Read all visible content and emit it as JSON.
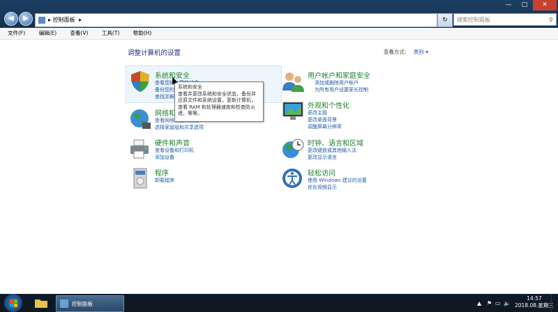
{
  "window": {
    "address_path": "控制面板",
    "address_sep": "▸",
    "search_placeholder": "搜索控制面板",
    "nav_back": "◀",
    "nav_forward": "▶",
    "refresh": "↻",
    "btn_minimize": "—",
    "btn_maximize": "□",
    "btn_close": "✕"
  },
  "menubar": {
    "items": [
      "文件(F)",
      "编辑(E)",
      "查看(V)",
      "工具(T)",
      "帮助(H)"
    ]
  },
  "main": {
    "heading": "调整计算机的设置",
    "view_by_label": "查看方式:",
    "view_by_value": "类别 ▾"
  },
  "categories": [
    {
      "title": "系统和安全",
      "links": [
        "查看您的计算机状态",
        "备份您的计算机",
        "查找并解决问题"
      ]
    },
    {
      "title": "网络和 Internet",
      "links": [
        "查看网络状态和任务",
        "选择家庭组和共享选项"
      ]
    },
    {
      "title": "硬件和声音",
      "links": [
        "查看设备和打印机",
        "添加设备"
      ]
    },
    {
      "title": "程序",
      "links": [
        "卸载程序"
      ]
    },
    {
      "title": "用户帐户和家庭安全",
      "links": [
        "添加或删除用户帐户",
        "为所有用户设置家长控制"
      ]
    },
    {
      "title": "外观和个性化",
      "links": [
        "更改主题",
        "更改桌面背景",
        "调整屏幕分辨率"
      ]
    },
    {
      "title": "时钟、语言和区域",
      "links": [
        "更改键盘或其他输入法",
        "更改显示语言"
      ]
    },
    {
      "title": "轻松访问",
      "links": [
        "使用 Windows 建议的设置",
        "优化视频显示"
      ]
    }
  ],
  "tooltip": {
    "title": "系统和安全",
    "body": "查看并更改系统和安全状态，备份并还原文件和系统设置，更新计算机，查看 RAM 和处理器速度和检查防火墙，等等。"
  },
  "taskbar": {
    "active_window_label": "控制面板",
    "clock_time": "14:57",
    "clock_date": "2018.08.星期三"
  },
  "colors": {
    "category_title": "#1e7e2e",
    "link": "#1e5aa8",
    "heading": "#1e3287",
    "titlebar": "#1c3f63"
  }
}
